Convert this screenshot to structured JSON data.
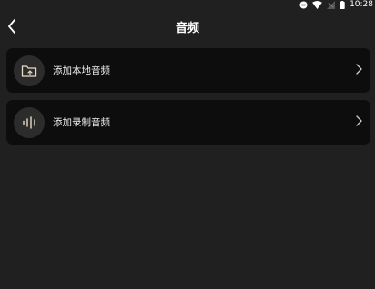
{
  "status_bar": {
    "time": "10:28"
  },
  "header": {
    "title": "音频"
  },
  "items": [
    {
      "label": "添加本地音频",
      "icon": "folder-upload-icon"
    },
    {
      "label": "添加录制音频",
      "icon": "audio-wave-icon"
    }
  ],
  "colors": {
    "background": "#202020",
    "card": "#0d0d0d",
    "icon_bg": "#2c2c2c",
    "icon_accent": "#e8dcc4"
  }
}
